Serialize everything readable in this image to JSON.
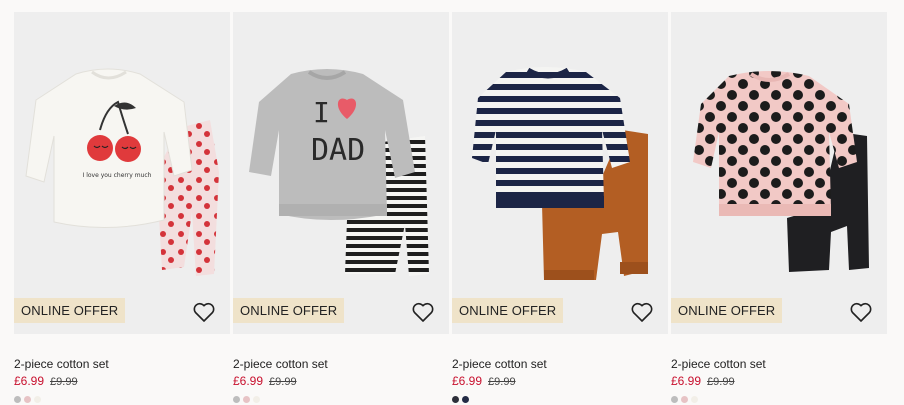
{
  "products": [
    {
      "badge": "ONLINE OFFER",
      "title": "2-piece cotton set",
      "price": "£6.99",
      "old_price": "£9.99",
      "print_text": "I love you cherry much",
      "swatches": [
        "#bdbdbd",
        "#e7c3c5",
        "#f2efe8"
      ]
    },
    {
      "badge": "ONLINE OFFER",
      "title": "2-piece cotton set",
      "price": "£6.99",
      "old_price": "£9.99",
      "print_text_1": "I",
      "print_text_2": "DAD",
      "swatches": [
        "#bdbdbd",
        "#e7c3c5",
        "#f2efe8"
      ]
    },
    {
      "badge": "ONLINE OFFER",
      "title": "2-piece cotton set",
      "price": "£6.99",
      "old_price": "£9.99",
      "swatches": [
        "#2d2f3a",
        "#232b45"
      ]
    },
    {
      "badge": "ONLINE OFFER",
      "title": "2-piece cotton set",
      "price": "£6.99",
      "old_price": "£9.99",
      "swatches": [
        "#bdbdbd",
        "#e7c3c5",
        "#f2efe8"
      ]
    }
  ],
  "colors": {
    "sale_price": "#c8102e",
    "badge_bg": "#efe3c9",
    "image_bg": "#eeeeee"
  },
  "icons": {
    "favorite": "heart-outline-icon"
  }
}
